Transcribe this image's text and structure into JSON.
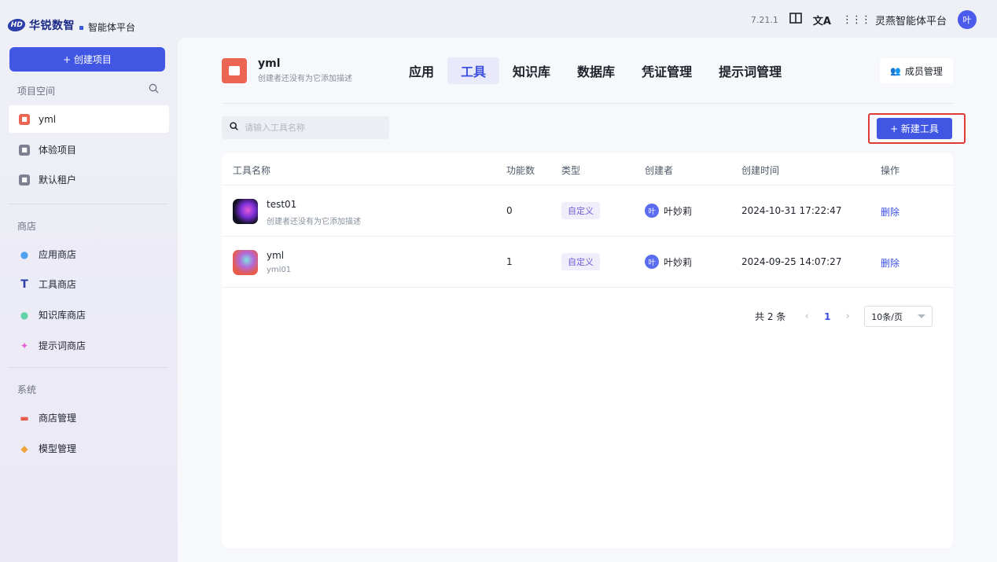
{
  "brand": {
    "name": "华锐数智",
    "subtitle": "智能体平台"
  },
  "topbar": {
    "version": "7.21.1",
    "platform": "灵燕智能体平台",
    "avatar": "叶"
  },
  "sidebar": {
    "new_project": "+ 创建项目",
    "project_space_label": "项目空间",
    "projects": [
      {
        "label": "yml",
        "color": "#ec6552"
      },
      {
        "label": "体验项目",
        "color": "#7c8091"
      },
      {
        "label": "默认租户",
        "color": "#7c8091"
      }
    ],
    "store_label": "商店",
    "store_items": [
      {
        "label": "应用商店",
        "icon": "robot-icon",
        "color": "#4ea1f0"
      },
      {
        "label": "工具商店",
        "icon": "tool-icon",
        "color": "#2c3ea8"
      },
      {
        "label": "知识库商店",
        "icon": "database-icon",
        "color": "#5fd3a6"
      },
      {
        "label": "提示词商店",
        "icon": "sparkle-icon",
        "color": "#e55bd0"
      }
    ],
    "system_label": "系统",
    "system_items": [
      {
        "label": "商店管理",
        "icon": "shop-icon",
        "color": "#e85a4a"
      },
      {
        "label": "模型管理",
        "icon": "cube-icon",
        "color": "#f0a33a"
      }
    ]
  },
  "project": {
    "name": "yml",
    "desc": "创建者还没有为它添加描述"
  },
  "tabs": [
    "应用",
    "工具",
    "知识库",
    "数据库",
    "凭证管理",
    "提示词管理"
  ],
  "member_button": "成员管理",
  "search": {
    "placeholder": "请输入工具名称"
  },
  "new_tool": "+ 新建工具",
  "table": {
    "headers": [
      "工具名称",
      "功能数",
      "类型",
      "创建者",
      "创建时间",
      "操作"
    ],
    "rows": [
      {
        "name": "test01",
        "desc": "创建者还没有为它添加描述",
        "count": "0",
        "type": "自定义",
        "creator_avatar": "叶",
        "creator": "叶妙莉",
        "created": "2024-10-31 17:22:47",
        "action": "删除"
      },
      {
        "name": "yml",
        "desc": "yml01",
        "count": "1",
        "type": "自定义",
        "creator_avatar": "叶",
        "creator": "叶妙莉",
        "created": "2024-09-25 14:07:27",
        "action": "删除"
      }
    ]
  },
  "pager": {
    "total": "共 2 条",
    "current": "1",
    "page_size": "10条/页"
  }
}
